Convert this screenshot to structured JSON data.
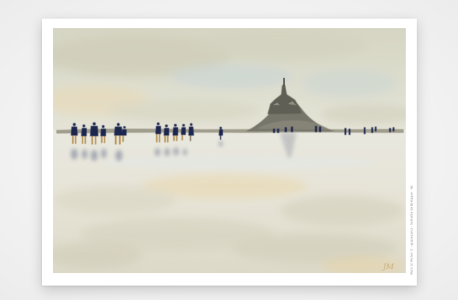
{
  "print": {
    "side_caption": "Mont St Michel © · @joyeyama · Scénette de Bretagne · A4",
    "signature_initials": "JM"
  },
  "palette": {
    "sky": "#dcdccd",
    "sky_blue_wash": "#c9d6d6",
    "sand": "#e7e4d8",
    "ochre_wash": "#e9d6a8",
    "mount": "#6b6a5e",
    "figure_navy": "#1f2750",
    "figure_legs": "#b08a4a",
    "reflection": "#8f95a6"
  }
}
